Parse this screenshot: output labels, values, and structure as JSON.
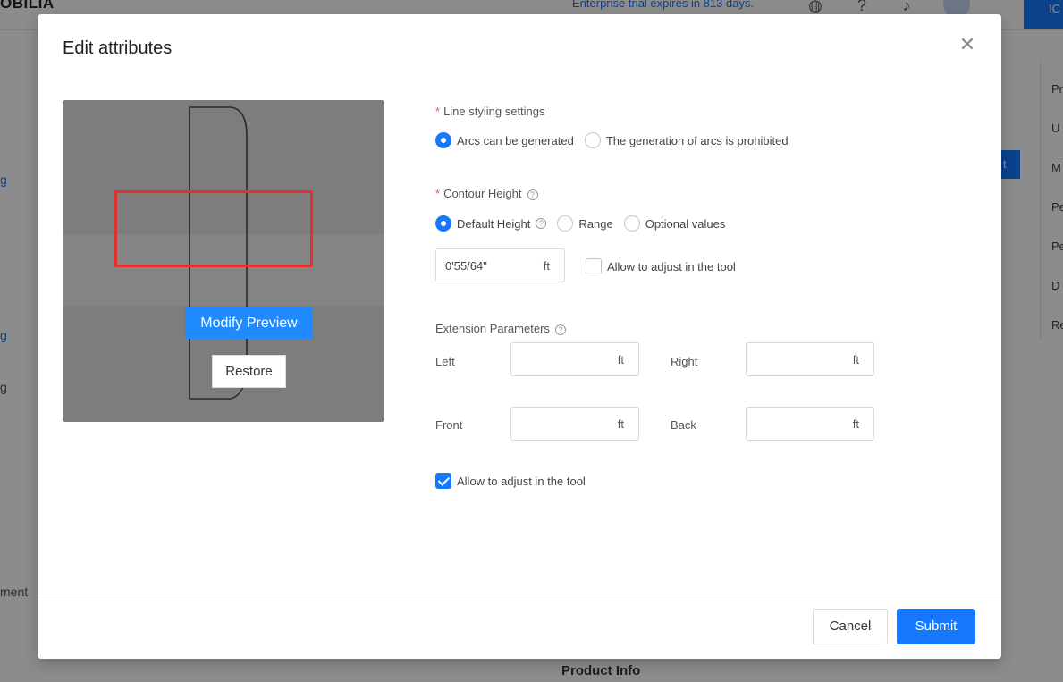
{
  "background": {
    "logo": "OBILIA",
    "trial_notice": "Enterprise trial expires in 813 days.",
    "right_button": "IC",
    "sidebar_items": [
      "g",
      "g",
      "g"
    ],
    "sidebar_bottom": "ment",
    "right_action": "t",
    "right_list": [
      "Pr",
      "U",
      "M",
      "Pe",
      "Pe",
      "D",
      "Re"
    ],
    "product_info": "Product Info"
  },
  "modal": {
    "title": "Edit attributes",
    "preview": {
      "modify_label": "Modify Preview",
      "restore_label": "Restore"
    },
    "line_styling": {
      "label": "Line styling settings",
      "options": [
        "Arcs can be generated",
        "The generation of arcs is prohibited"
      ],
      "selected": 0
    },
    "contour_height": {
      "label": "Contour Height",
      "options": [
        "Default Height",
        "Range",
        "Optional values"
      ],
      "selected": 0,
      "value": "0'55/64\"",
      "unit": "ft",
      "allow_adjust_label": "Allow to adjust in the tool",
      "allow_adjust_checked": false
    },
    "extension": {
      "label": "Extension Parameters",
      "left_label": "Left",
      "right_label": "Right",
      "front_label": "Front",
      "back_label": "Back",
      "unit": "ft",
      "allow_adjust_label": "Allow to adjust in the tool",
      "allow_adjust_checked": true
    },
    "footer": {
      "cancel_label": "Cancel",
      "submit_label": "Submit"
    }
  }
}
